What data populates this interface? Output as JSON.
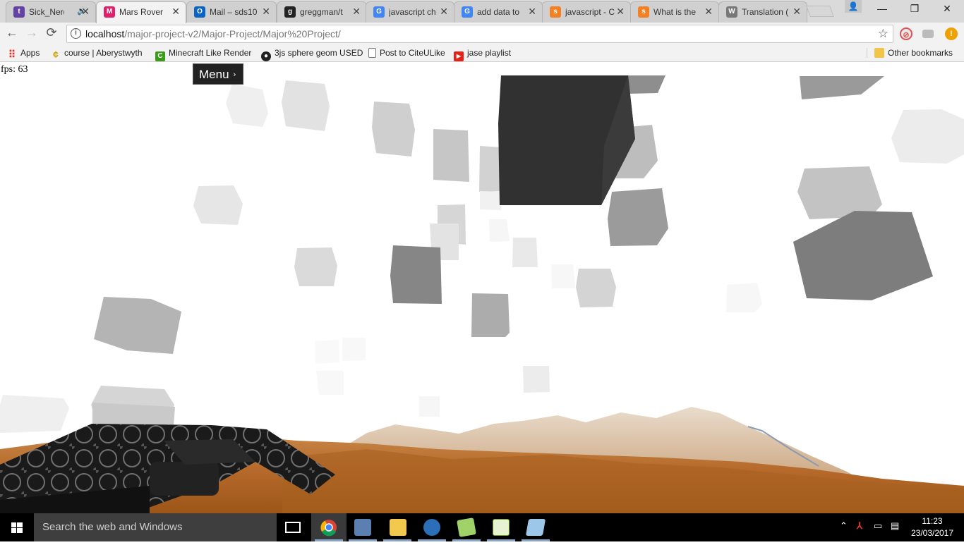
{
  "tabs": [
    {
      "title": "Sick_Nerd",
      "color": "#6441a5",
      "glyph": "t"
    },
    {
      "title": "Mars Rover",
      "color": "#e0206a",
      "glyph": "M",
      "active": true
    },
    {
      "title": "Mail – sds10",
      "color": "#0a64c8",
      "glyph": "O"
    },
    {
      "title": "greggman/t",
      "color": "#222222",
      "glyph": "g"
    },
    {
      "title": "javascript ch",
      "color": "#4285f4",
      "glyph": "G"
    },
    {
      "title": "add data to",
      "color": "#4285f4",
      "glyph": "G"
    },
    {
      "title": "javascript - C",
      "color": "#f48024",
      "glyph": "s"
    },
    {
      "title": "What is the",
      "color": "#f48024",
      "glyph": "s"
    },
    {
      "title": "Translation (",
      "color": "#555555",
      "glyph": "W"
    }
  ],
  "window": {
    "minimize": "—",
    "restore": "❐",
    "close": "✕"
  },
  "toolbar": {
    "back": "←",
    "forward": "→",
    "reload": "⟳",
    "url_host": "localhost",
    "url_path": "/major-project-v2/Major-Project/Major%20Project/",
    "star": "☆"
  },
  "bookmarks": [
    {
      "label": "Apps",
      "color": "#d93025",
      "glyph": "⋮"
    },
    {
      "label": "course | Aberystwyth",
      "color": "#c8a000",
      "glyph": "¢"
    },
    {
      "label": "Minecraft Like Render",
      "color": "#3a9a1a",
      "glyph": "C"
    },
    {
      "label": "3js sphere geom USED",
      "color": "#222222",
      "glyph": "●"
    },
    {
      "label": "Post to CiteULike",
      "color": "#ffffff",
      "glyph": "▯"
    },
    {
      "label": "jase playlist",
      "color": "#e62117",
      "glyph": "▶"
    }
  ],
  "other_bookmarks": "Other bookmarks",
  "page": {
    "fps": "fps: 63",
    "menu": "Menu",
    "menu_chevron": "›"
  },
  "taskbar": {
    "search_placeholder": "Search the web and Windows",
    "time": "11:23",
    "date": "23/03/2017"
  }
}
